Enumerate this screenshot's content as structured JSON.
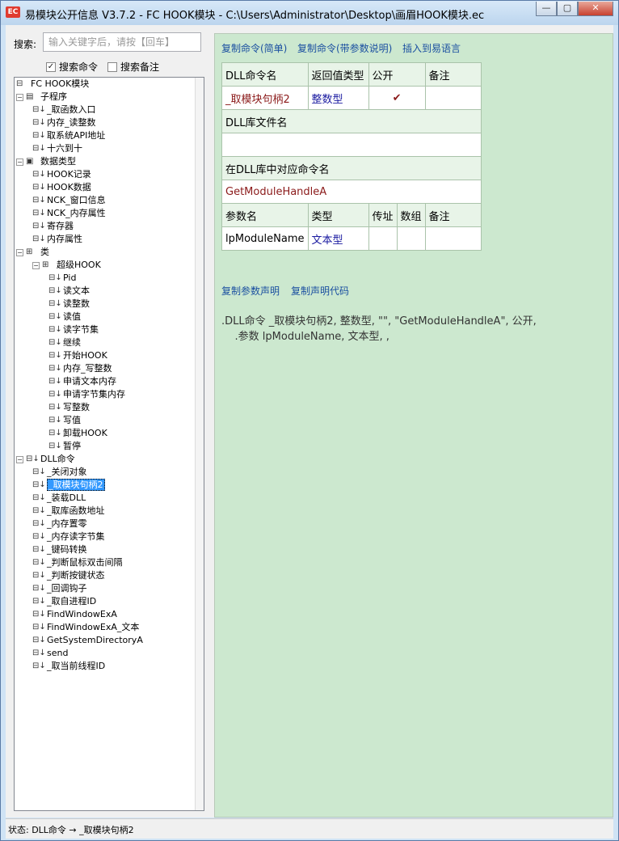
{
  "window": {
    "title": "易模块公开信息 V3.7.2 - FC HOOK模块 - C:\\Users\\Administrator\\Desktop\\画眉HOOK模块.ec",
    "icon_text": "EC",
    "minimize": "—",
    "maximize": "▢",
    "close": "✕"
  },
  "search": {
    "label": "搜索:",
    "placeholder": "输入关键字后，请按【回车】",
    "search_commands": "搜索命令",
    "search_commands_checked": true,
    "search_notes": "搜索备注",
    "search_notes_checked": false
  },
  "tree": {
    "root": "FC HOOK模块",
    "group_subprograms": "子程序",
    "subprograms": [
      "_取函数入口",
      "内存_读整数",
      "取系统API地址",
      "十六到十"
    ],
    "group_datatypes": "数据类型",
    "datatypes": [
      "HOOK记录",
      "HOOK数据",
      "NCK_窗口信息",
      "NCK_内存属性",
      "寄存器",
      "内存属性"
    ],
    "group_classes": "类",
    "class_name": "超级HOOK",
    "class_methods": [
      "Pid",
      "读文本",
      "读整数",
      "读值",
      "读字节集",
      "继续",
      "开始HOOK",
      "内存_写整数",
      "申请文本内存",
      "申请字节集内存",
      "写整数",
      "写值",
      "卸载HOOK",
      "暂停"
    ],
    "group_dll": "DLL命令",
    "dll_commands": [
      "_关闭对象",
      "_取模块句柄2",
      "_装载DLL",
      "_取库函数地址",
      "_内存置零",
      "_内存读字节集",
      "_键码转换",
      "_判断鼠标双击间隔",
      "_判断按键状态",
      "_回调钩子",
      "_取自进程ID",
      "FindWindowExA",
      "FindWindowExA_文本",
      "GetSystemDirectoryA",
      "send",
      "_取当前线程ID"
    ]
  },
  "links": {
    "copy_simple": "复制命令(简单)",
    "copy_with_params": "复制命令(带参数说明)",
    "insert_to_e": "插入到易语言",
    "copy_param_decl": "复制参数声明",
    "copy_decl_code": "复制声明代码"
  },
  "table": {
    "h_dll_name": "DLL命令名",
    "h_return_type": "返回值类型",
    "h_public": "公开",
    "h_note": "备注",
    "v_dll_name": "_取模块句柄2",
    "v_return_type": "整数型",
    "v_public": "✔",
    "v_note": "",
    "h_lib_file": "DLL库文件名",
    "v_lib_file": "",
    "h_cmd_in_lib": "在DLL库中对应命令名",
    "v_cmd_in_lib": "GetModuleHandleA",
    "h_param_name": "参数名",
    "h_param_type": "类型",
    "h_byref": "传址",
    "h_array": "数组",
    "h_param_note": "备注",
    "v_param_name": "lpModuleName",
    "v_param_type": "文本型"
  },
  "code": {
    "line1": ".DLL命令 _取模块句柄2, 整数型, \"\", \"GetModuleHandleA\", 公开,",
    "line2": "    .参数 lpModuleName, 文本型, ,"
  },
  "status": {
    "text": "状态: DLL命令 → _取模块句柄2"
  },
  "colors": {
    "right_panel_bg": "#cce8cf",
    "selection": "#3399ff",
    "link": "#1a4fa0"
  }
}
